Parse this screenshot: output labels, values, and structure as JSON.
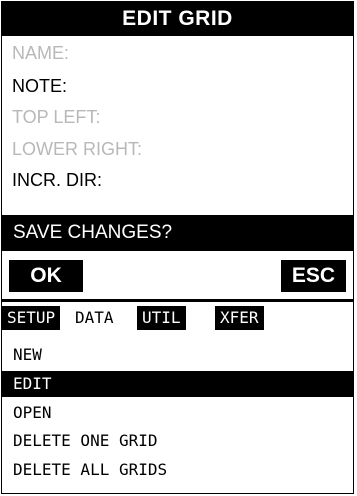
{
  "dialog": {
    "title": "EDIT GRID",
    "fields": [
      {
        "label": "NAME:",
        "enabled": false
      },
      {
        "label": "NOTE:",
        "enabled": true
      },
      {
        "label": "TOP LEFT:",
        "enabled": false
      },
      {
        "label": "LOWER RIGHT:",
        "enabled": false
      },
      {
        "label": "INCR. DIR:",
        "enabled": true
      }
    ],
    "prompt": "SAVE CHANGES?",
    "ok_label": "OK",
    "esc_label": "ESC"
  },
  "tabs": [
    {
      "label": "SETUP",
      "active": false
    },
    {
      "label": "DATA",
      "active": true
    },
    {
      "label": "UTIL",
      "active": false
    },
    {
      "label": "XFER",
      "active": false
    }
  ],
  "menu": {
    "items": [
      "NEW",
      "EDIT",
      "OPEN",
      "DELETE ONE GRID",
      "DELETE ALL GRIDS"
    ],
    "selected_index": 1
  },
  "colors": {
    "foreground": "#000000",
    "background": "#ffffff",
    "disabled": "#b8b8b8"
  }
}
